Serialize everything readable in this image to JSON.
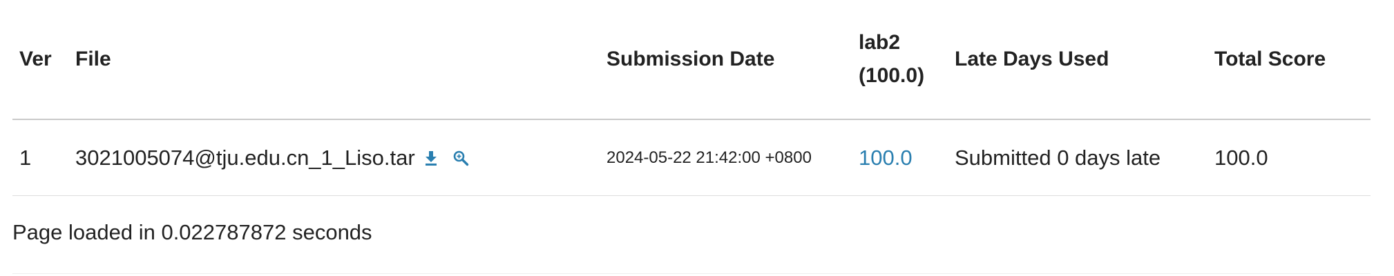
{
  "table": {
    "headers": {
      "ver": "Ver",
      "file": "File",
      "submission_date": "Submission Date",
      "lab_line1": "lab2",
      "lab_line2": "(100.0)",
      "late_days": "Late Days Used",
      "total_score": "Total Score"
    },
    "rows": [
      {
        "ver": "1",
        "file": "3021005074@tju.edu.cn_1_Liso.tar",
        "submission_date": "2024-05-22 21:42:00 +0800",
        "lab_score": "100.0",
        "late_days": "Submitted 0 days late",
        "total_score": "100.0"
      }
    ]
  },
  "icons": {
    "download": "download-icon",
    "view": "magnifier-icon",
    "accent_color": "#2a7fb0"
  },
  "footer": {
    "text": "Page loaded in 0.022787872 seconds"
  }
}
